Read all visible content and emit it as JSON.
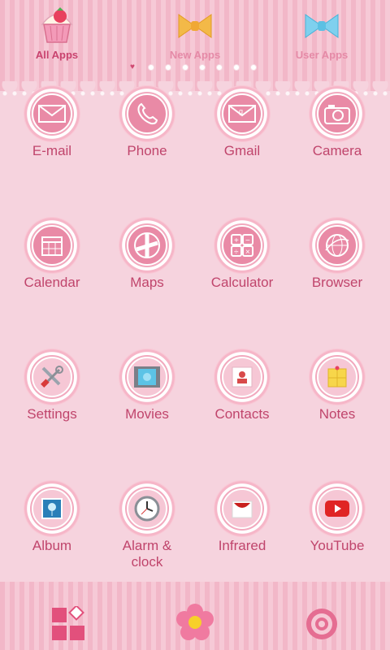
{
  "tabs": [
    {
      "label": "All Apps",
      "art": "cupcake-icon",
      "active": true
    },
    {
      "label": "New Apps",
      "art": "ribbon-bow-icon",
      "active": false
    },
    {
      "label": "User Apps",
      "art": "ribbon-bow-icon",
      "active": false
    }
  ],
  "page_indicator": {
    "current": 1,
    "total": 8
  },
  "apps": [
    {
      "label": "E-mail",
      "icon": "envelope-icon"
    },
    {
      "label": "Phone",
      "icon": "phone-handset-icon"
    },
    {
      "label": "Gmail",
      "icon": "envelope-icon"
    },
    {
      "label": "Camera",
      "icon": "camera-icon"
    },
    {
      "label": "Calendar",
      "icon": "calendar-icon"
    },
    {
      "label": "Maps",
      "icon": "map-icon"
    },
    {
      "label": "Calculator",
      "icon": "calculator-icon"
    },
    {
      "label": "Browser",
      "icon": "globe-icon"
    },
    {
      "label": "Settings",
      "icon": "tools-icon"
    },
    {
      "label": "Movies",
      "icon": "film-icon"
    },
    {
      "label": "Contacts",
      "icon": "contact-card-icon"
    },
    {
      "label": "Notes",
      "icon": "sticky-note-icon"
    },
    {
      "label": "Album",
      "icon": "photo-icon"
    },
    {
      "label": "Alarm &\nclock",
      "icon": "clock-icon"
    },
    {
      "label": "Infrared",
      "icon": "infrared-icon"
    },
    {
      "label": "YouTube",
      "icon": "youtube-icon"
    }
  ],
  "dock": [
    {
      "name": "widgets-icon"
    },
    {
      "name": "flower-home-icon"
    },
    {
      "name": "settings-gear-icon"
    }
  ],
  "colors": {
    "label": "#c0456c",
    "accent": "#e98aa6",
    "background": "#f6d3de"
  }
}
